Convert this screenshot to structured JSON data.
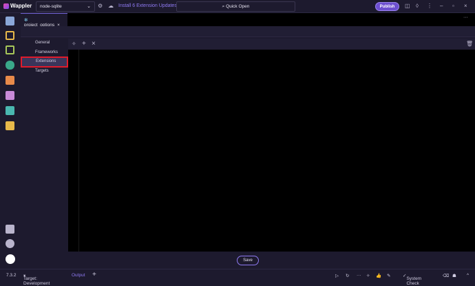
{
  "app": {
    "name": "Wappler"
  },
  "topbar": {
    "project": "node-sqlite",
    "update_link": "Install 6 Extension Updates",
    "quick_open": "Quick Open",
    "publish": "Publish"
  },
  "tabs": [
    {
      "label": "project_options"
    }
  ],
  "nav": {
    "items": [
      {
        "label": "General"
      },
      {
        "label": "Frameworks"
      },
      {
        "label": "Extensions",
        "selected": true
      },
      {
        "label": "Targets"
      }
    ]
  },
  "footer": {
    "save": "Save"
  },
  "status": {
    "version": "7.3.2",
    "target": "Target: Development",
    "output": "Output",
    "system_check": "System Check"
  },
  "colors": {
    "accent": "#6d4fd0",
    "highlight": "#e01b2b"
  }
}
